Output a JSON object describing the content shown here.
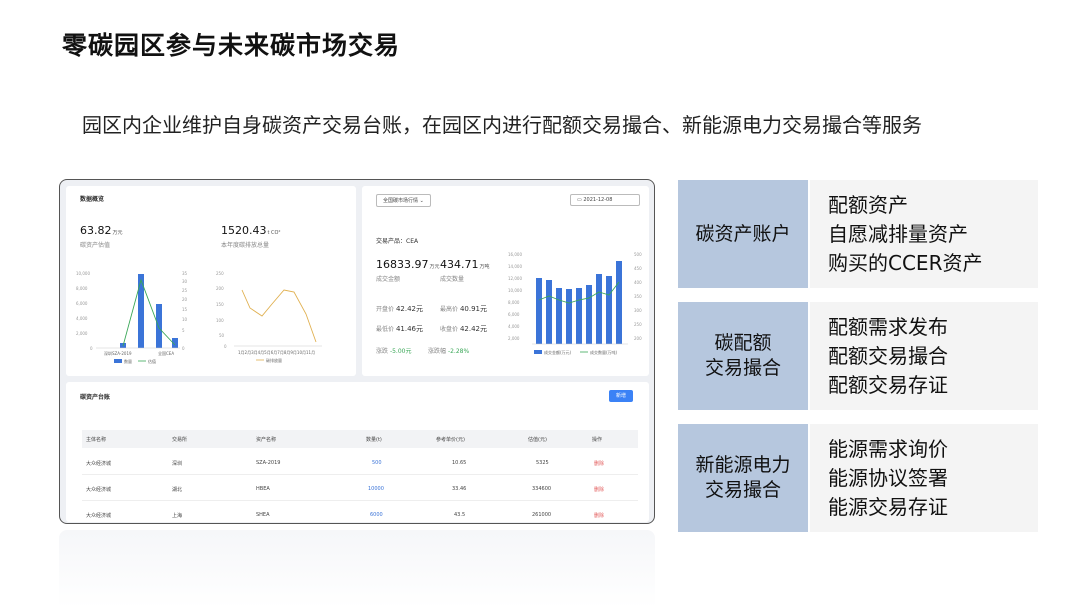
{
  "slide": {
    "title": "零碳园区参与未来碳市场交易",
    "subtitle": "园区内企业维护自身碳资产交易台账，在园区内进行配额交易撮合、新能源电力交易撮合等服务"
  },
  "dashboard": {
    "overview": {
      "title": "数据概览",
      "asset_value": "63.82",
      "asset_value_unit": "万元",
      "asset_value_label": "碳资产估值",
      "emission": "1520.43",
      "emission_unit": "t CO²",
      "emission_label": "本年度碳排放总量",
      "chart_left_legend": [
        "数量",
        "估值"
      ],
      "chart_left_x_labels": [
        "深圳SZA-2019",
        "全国CEA"
      ],
      "chart_right_legend": "碳排放量"
    },
    "market": {
      "select_label": "全国碳市场行情",
      "date": "2021-12-08",
      "product_label": "交易产品：",
      "product": "CEA",
      "turnover": "16833.97",
      "turnover_unit": "万元",
      "turnover_label": "成交金额",
      "volume": "434.71",
      "volume_unit": "万吨",
      "volume_label": "成交数量",
      "open_label": "开盘价",
      "open": "42.42元",
      "high_label": "最高价",
      "high": "40.91元",
      "low_label": "最低价",
      "low": "41.46元",
      "close_label": "收盘价",
      "close": "42.42元",
      "change_label": "涨跌",
      "change": "-5.00元",
      "pct_label": "涨跌幅",
      "pct": "-2.28%",
      "legend": [
        "成交金额(万元)",
        "成交数量(万吨)"
      ]
    },
    "ledger": {
      "title": "碳资产台账",
      "add_button": "新增",
      "columns": [
        "主体名称",
        "交易所",
        "资产名称",
        "数量(t)",
        "参考单价(元)",
        "估值(元)",
        "操作"
      ],
      "rows": [
        [
          "大众经济城",
          "深圳",
          "SZA-2019",
          "500",
          "10.65",
          "5325",
          "删除"
        ],
        [
          "大众经济城",
          "湖北",
          "HBEA",
          "10000",
          "33.46",
          "334600",
          "删除"
        ],
        [
          "大众经济城",
          "上海",
          "SHEA",
          "6000",
          "43.5",
          "261000",
          "删除"
        ]
      ]
    }
  },
  "services": [
    {
      "name": "碳资产账户",
      "items": [
        "配额资产",
        "自愿减排量资产",
        "购买的CCER资产"
      ]
    },
    {
      "name": "碳配额\n交易撮合",
      "items": [
        "配额需求发布",
        "配额交易撮合",
        "配额交易存证"
      ]
    },
    {
      "name": "新能源电力\n交易撮合",
      "items": [
        "能源需求询价",
        "能源协议签署",
        "能源交易存证"
      ]
    }
  ],
  "colors": {
    "panel_label_bg": "#b6c7de",
    "panel_list_bg": "#f4f4f4",
    "bar": "#3b74d8",
    "line": "#3aa757",
    "line_orange": "#e0b050"
  }
}
